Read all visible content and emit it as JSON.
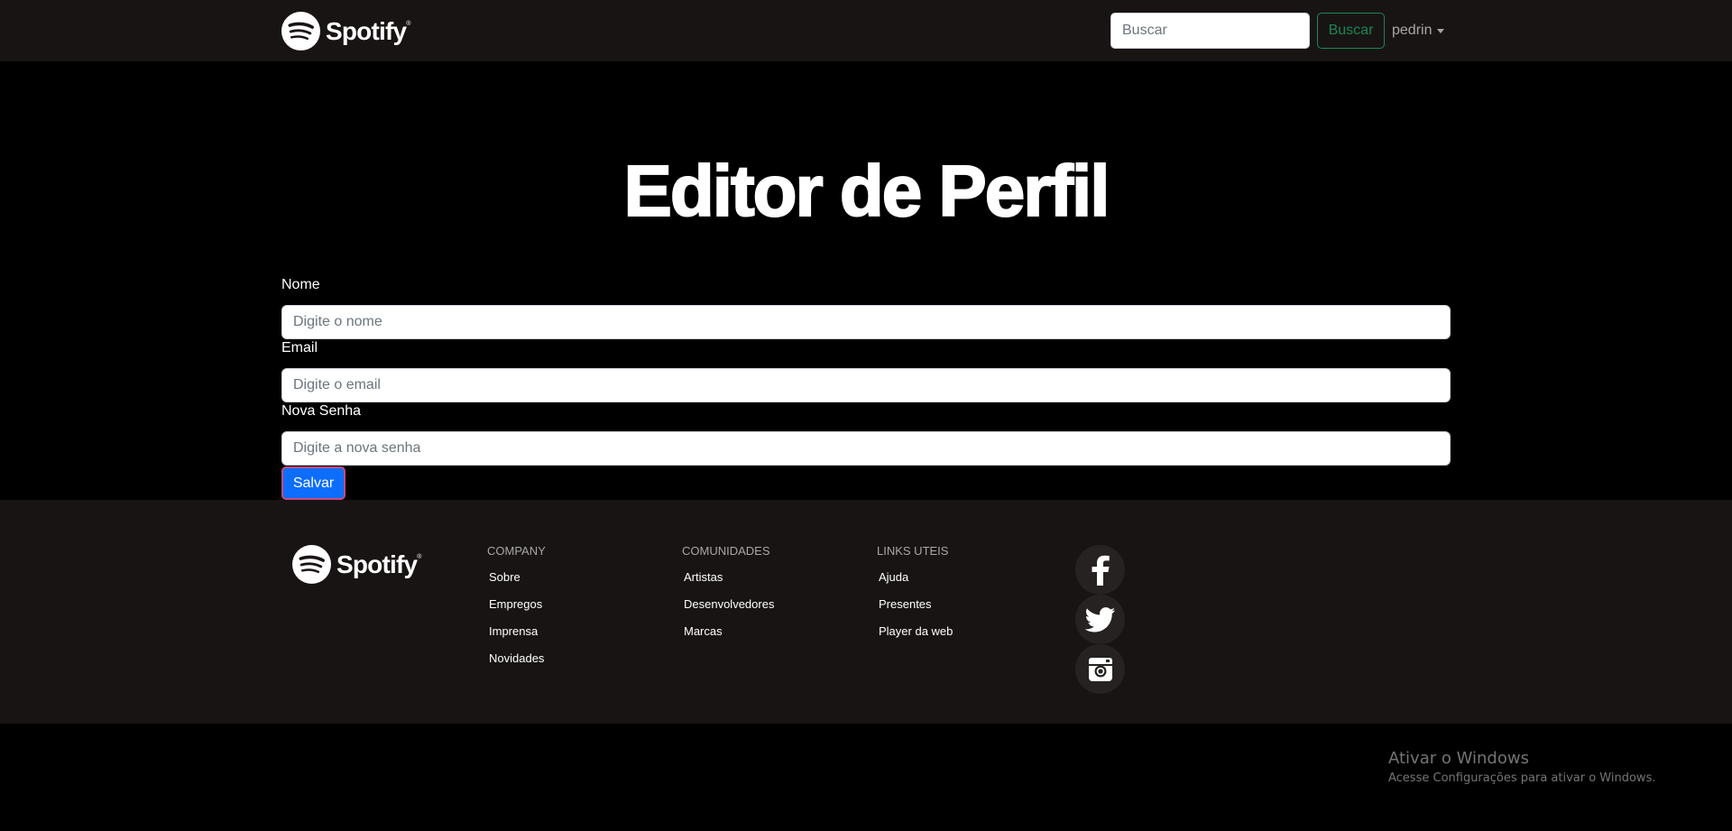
{
  "navbar": {
    "brand_name": "Spotify",
    "brand_mark": "®",
    "search_placeholder": "Buscar",
    "search_button_label": "Buscar",
    "user_name": "pedrin"
  },
  "main": {
    "title": "Editor de Perfil",
    "fields": [
      {
        "label": "Nome",
        "placeholder": "Digite o nome"
      },
      {
        "label": "Email",
        "placeholder": "Digite o email"
      },
      {
        "label": "Nova Senha",
        "placeholder": "Digite a nova senha"
      }
    ],
    "save_label": "Salvar"
  },
  "footer": {
    "brand_name": "Spotify",
    "brand_mark": "®",
    "columns": [
      {
        "title": "COMPANY",
        "links": [
          "Sobre",
          "Empregos",
          "Imprensa",
          "Novidades"
        ]
      },
      {
        "title": "COMUNIDADES",
        "links": [
          "Artistas",
          "Desenvolvedores",
          "Marcas"
        ]
      },
      {
        "title": "LINKS UTEIS",
        "links": [
          "Ajuda",
          "Presentes",
          "Player da web"
        ]
      }
    ],
    "social": [
      "facebook-icon",
      "twitter-icon",
      "instagram-icon"
    ]
  },
  "watermark": {
    "title": "Ativar o Windows",
    "subtitle": "Acesse Configurações para ativar o Windows."
  },
  "colors": {
    "navbar_bg": "#191414",
    "page_bg": "#000000",
    "accent_green": "#198754",
    "primary_blue": "#0d6efd"
  }
}
